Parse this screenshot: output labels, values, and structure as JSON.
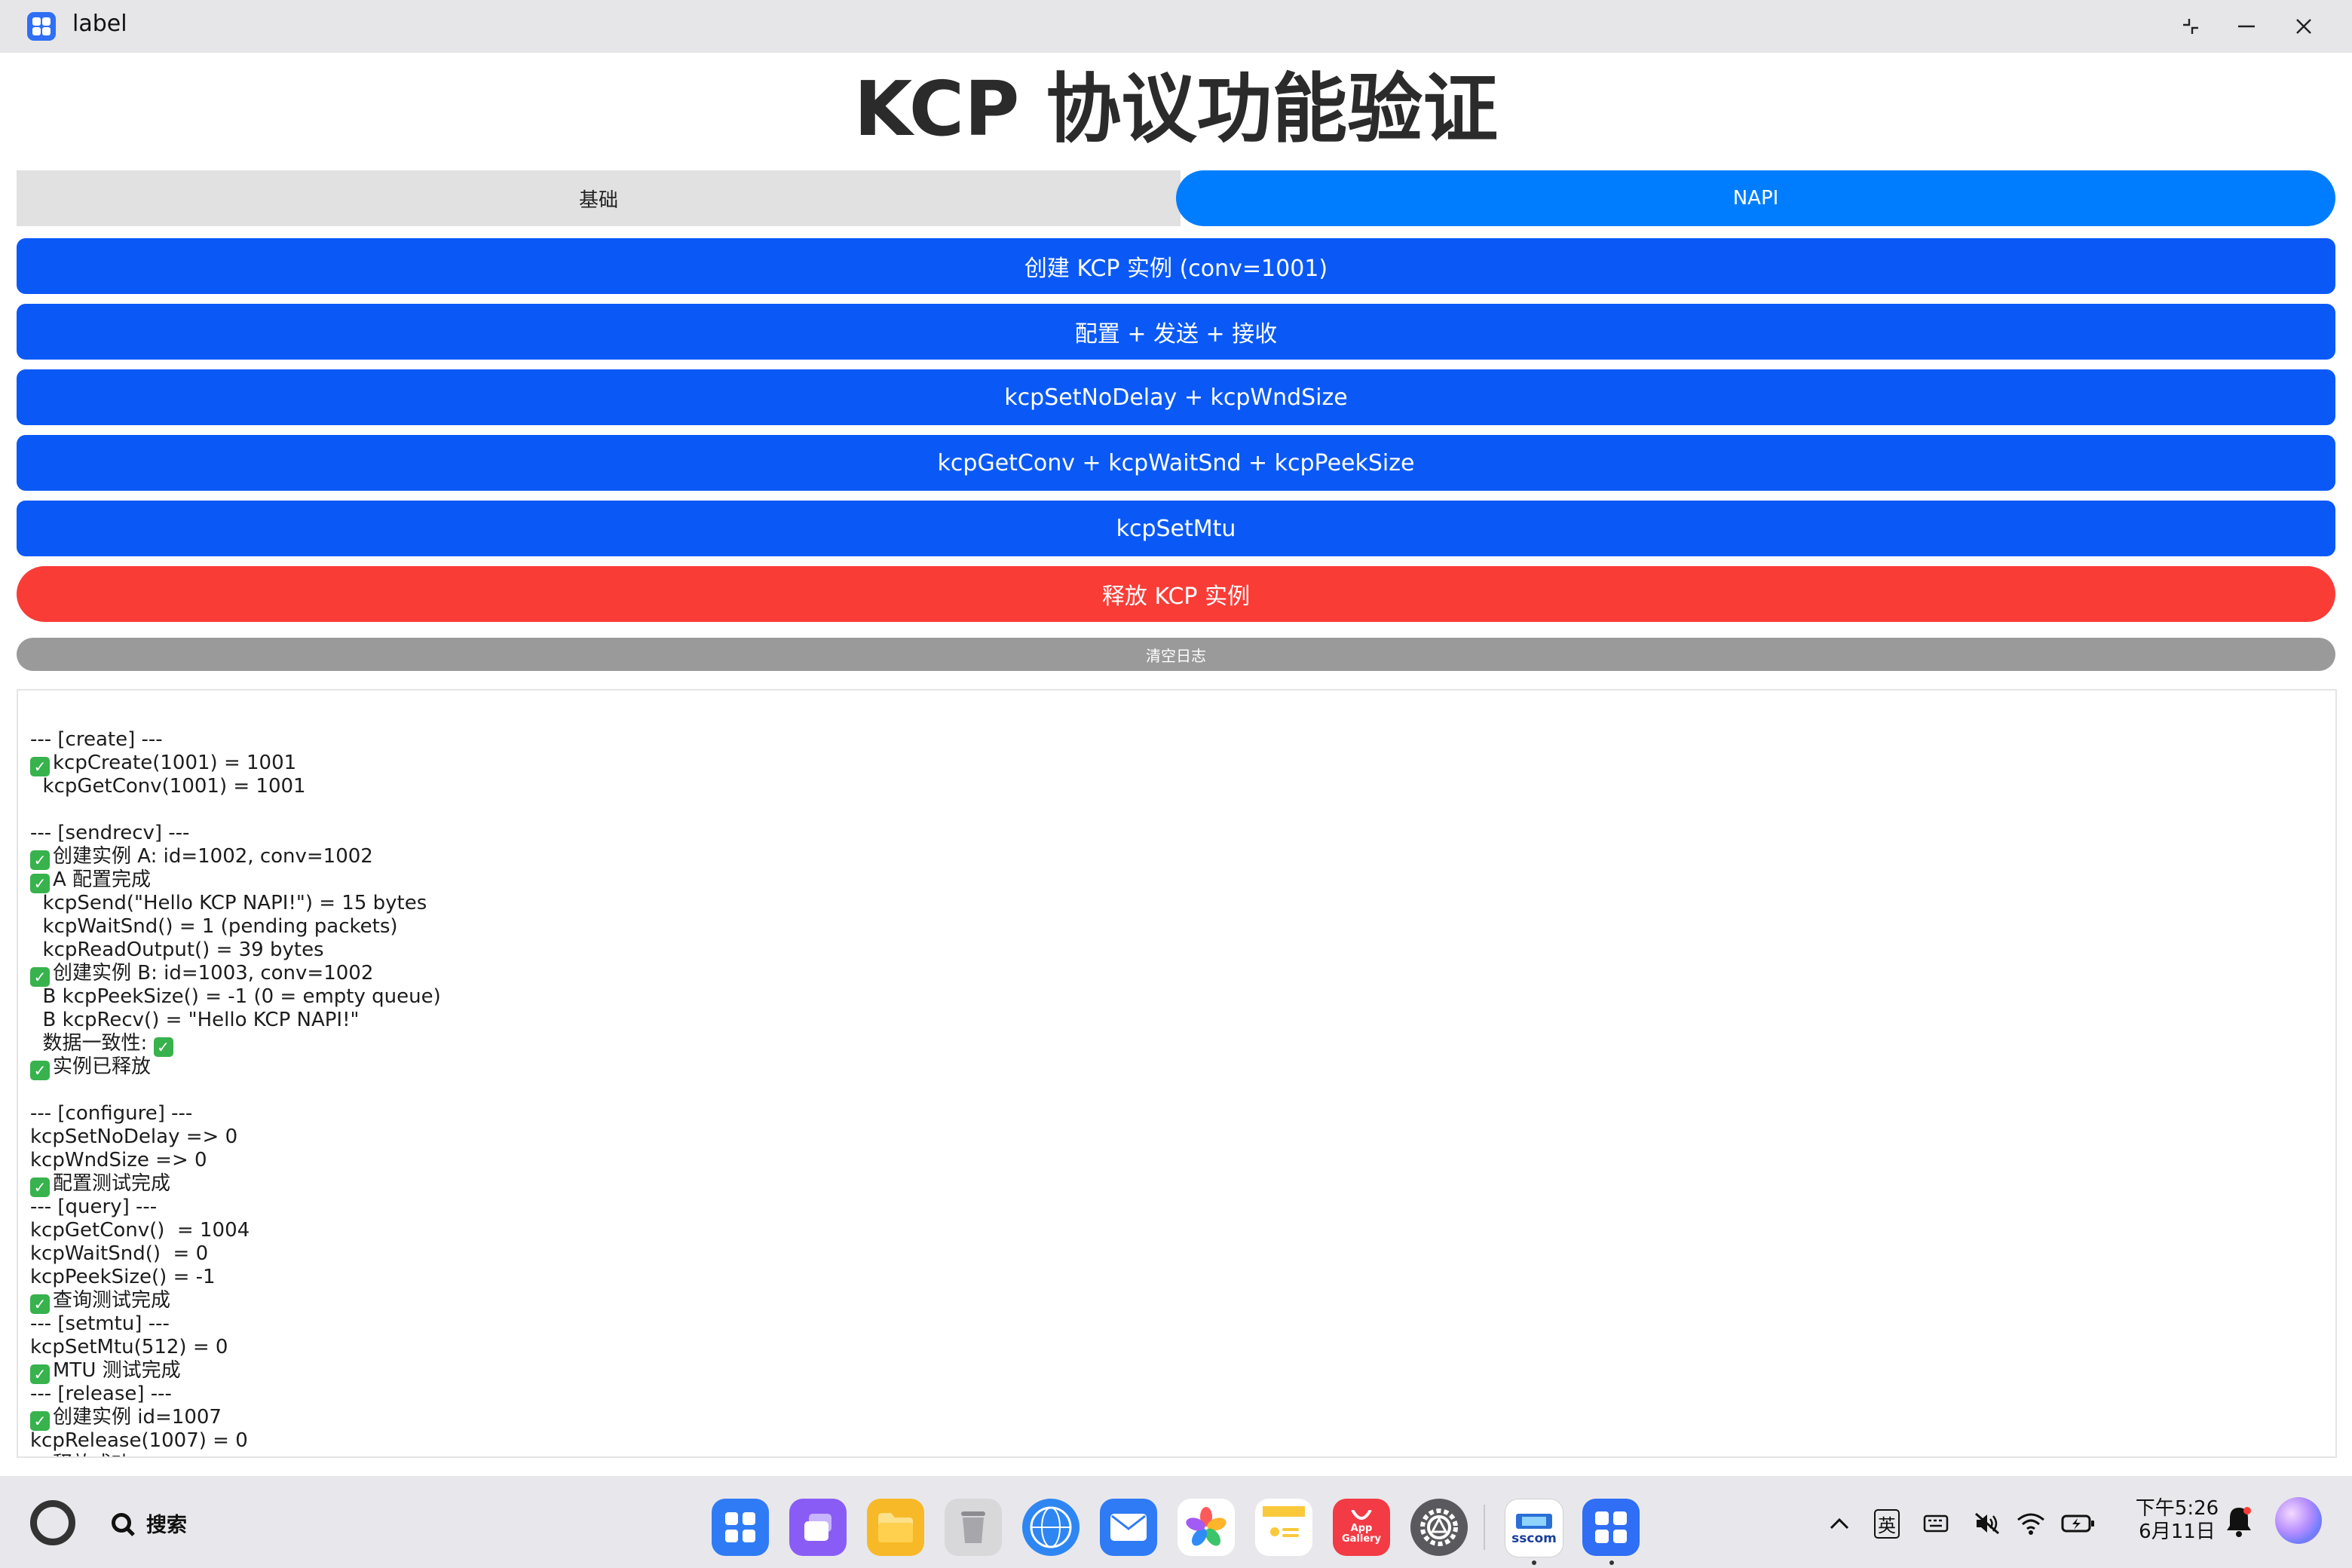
{
  "window": {
    "title": "label",
    "icon": "grid-app-icon",
    "controls": [
      "restore-icon",
      "minimize-icon",
      "close-icon"
    ]
  },
  "page": {
    "title": "KCP 协议功能验证"
  },
  "tabs": [
    {
      "label": "基础",
      "active": false
    },
    {
      "label": "NAPI",
      "active": true
    }
  ],
  "actions": [
    {
      "label": "创建 KCP 实例 (conv=1001)",
      "color": "#0a59f7"
    },
    {
      "label": "配置 + 发送 + 接收",
      "color": "#0a59f7"
    },
    {
      "label": "kcpSetNoDelay + kcpWndSize",
      "color": "#0a59f7"
    },
    {
      "label": "kcpGetConv + kcpWaitSnd + kcpPeekSize",
      "color": "#0a59f7"
    },
    {
      "label": "kcpSetMtu",
      "color": "#0a59f7"
    },
    {
      "label": "释放 KCP 实例",
      "color": "#fa3c37"
    }
  ],
  "clear_button": {
    "label": "清空日志"
  },
  "log": [
    {
      "check": false,
      "pre": "",
      "text": "--- [create] ---",
      "post": false
    },
    {
      "check": true,
      "pre": "",
      "text": "kcpCreate(1001) = 1001",
      "post": false
    },
    {
      "check": false,
      "pre": "  ",
      "text": "kcpGetConv(1001) = 1001",
      "post": false
    },
    {
      "check": false,
      "pre": "",
      "text": "",
      "post": false
    },
    {
      "check": false,
      "pre": "",
      "text": "--- [sendrecv] ---",
      "post": false
    },
    {
      "check": true,
      "pre": "",
      "text": "创建实例 A: id=1002, conv=1002",
      "post": false
    },
    {
      "check": true,
      "pre": "",
      "text": "A 配置完成",
      "post": false
    },
    {
      "check": false,
      "pre": "  ",
      "text": "kcpSend(\"Hello KCP NAPI!\") = 15 bytes",
      "post": false
    },
    {
      "check": false,
      "pre": "  ",
      "text": "kcpWaitSnd() = 1 (pending packets)",
      "post": false
    },
    {
      "check": false,
      "pre": "  ",
      "text": "kcpReadOutput() = 39 bytes",
      "post": false
    },
    {
      "check": true,
      "pre": "",
      "text": "创建实例 B: id=1003, conv=1002",
      "post": false
    },
    {
      "check": false,
      "pre": "  ",
      "text": "B kcpPeekSize() = -1 (0 = empty queue)",
      "post": false
    },
    {
      "check": false,
      "pre": "  ",
      "text": "B kcpRecv() = \"Hello KCP NAPI!\"",
      "post": false
    },
    {
      "check": false,
      "pre": "  ",
      "text": "数据一致性: ",
      "post": true
    },
    {
      "check": true,
      "pre": "",
      "text": "实例已释放",
      "post": false
    },
    {
      "check": false,
      "pre": "",
      "text": "",
      "post": false
    },
    {
      "check": false,
      "pre": "",
      "text": "--- [configure] ---",
      "post": false
    },
    {
      "check": false,
      "pre": "",
      "text": "kcpSetNoDelay => 0",
      "post": false
    },
    {
      "check": false,
      "pre": "",
      "text": "kcpWndSize => 0",
      "post": false
    },
    {
      "check": true,
      "pre": "",
      "text": "配置测试完成",
      "post": false
    },
    {
      "check": false,
      "pre": "",
      "text": "--- [query] ---",
      "post": false
    },
    {
      "check": false,
      "pre": "",
      "text": "kcpGetConv()  = 1004",
      "post": false
    },
    {
      "check": false,
      "pre": "",
      "text": "kcpWaitSnd()  = 0",
      "post": false
    },
    {
      "check": false,
      "pre": "",
      "text": "kcpPeekSize() = -1",
      "post": false
    },
    {
      "check": true,
      "pre": "",
      "text": "查询测试完成",
      "post": false
    },
    {
      "check": false,
      "pre": "",
      "text": "--- [setmtu] ---",
      "post": false
    },
    {
      "check": false,
      "pre": "",
      "text": "kcpSetMtu(512) = 0",
      "post": false
    },
    {
      "check": true,
      "pre": "",
      "text": "MTU 测试完成",
      "post": false
    },
    {
      "check": false,
      "pre": "",
      "text": "--- [release] ---",
      "post": false
    },
    {
      "check": true,
      "pre": "",
      "text": "创建实例 id=1007",
      "post": false
    },
    {
      "check": false,
      "pre": "",
      "text": "kcpRelease(1007) = 0",
      "post": false
    },
    {
      "check": true,
      "pre": "",
      "text": "释放成功",
      "post": false
    }
  ],
  "taskbar": {
    "search_label": "搜索",
    "dock": [
      {
        "name": "launcher-icon",
        "color": "#2f7bf6",
        "running": false
      },
      {
        "name": "multitask-icon",
        "color": "#8a5cf6",
        "running": false
      },
      {
        "name": "files-icon",
        "color": "#f7b928",
        "running": false
      },
      {
        "name": "trash-icon",
        "color": "#d5d5d8",
        "running": false
      },
      {
        "name": "browser-icon",
        "color": "#2e86f3",
        "running": false
      },
      {
        "name": "mail-icon",
        "color": "#2f7bf6",
        "running": false
      },
      {
        "name": "gallery-icon",
        "color": "#ffffff",
        "running": false
      },
      {
        "name": "notes-icon",
        "color": "#f9c93b",
        "running": false
      },
      {
        "name": "app-gallery-icon",
        "color": "#f23b45",
        "running": false
      },
      {
        "name": "settings-icon",
        "color": "#5a5a5e",
        "running": false
      },
      {
        "name": "sscom-icon",
        "color": "#ffffff",
        "running": true
      },
      {
        "name": "label-app-icon",
        "color": "#2f6ef5",
        "running": true
      }
    ],
    "app_gallery_text": "App Gallery",
    "sscom_text": "sscom",
    "ime_label": "英",
    "clock": {
      "time": "下午5:26",
      "date": "6月11日"
    }
  }
}
